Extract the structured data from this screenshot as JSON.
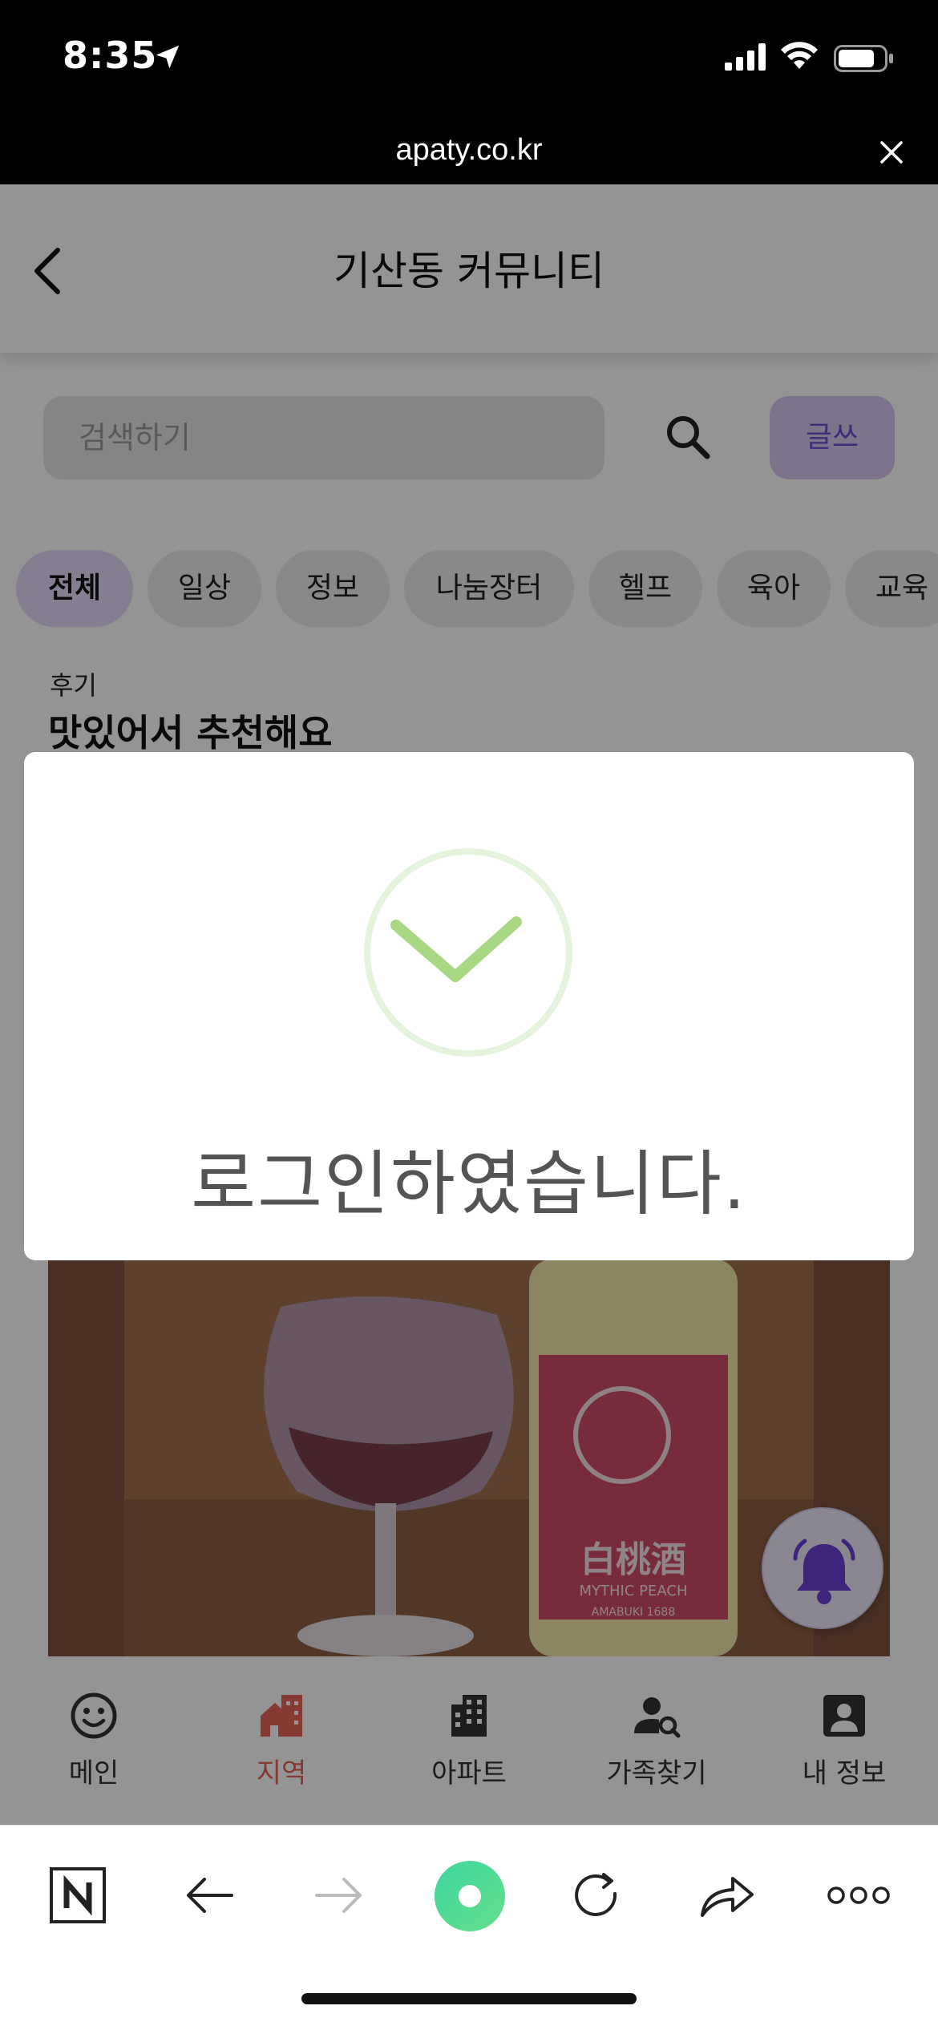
{
  "status_bar": {
    "time": "8:35",
    "icons": [
      "location-arrow-icon",
      "signal-bars-icon",
      "wifi-icon",
      "battery-icon"
    ]
  },
  "url_bar": {
    "url": "apaty.co.kr",
    "close_icon": "close-icon"
  },
  "header": {
    "back_icon": "chevron-left-icon",
    "title": "기산동 커뮤니티"
  },
  "search": {
    "placeholder": "검색하기",
    "search_icon": "search-icon",
    "write_label": "글쓰"
  },
  "categories": {
    "items": [
      "전체",
      "일상",
      "정보",
      "나눔장터",
      "헬프",
      "육아",
      "교육"
    ],
    "active": "전체"
  },
  "post": {
    "category": "후기",
    "title": "맛있어서 추천해요",
    "image_label_text": "白桃酒",
    "image_sub_text": "MYTHIC PEACH",
    "image_brand_text": "AMABUKI 1688"
  },
  "fab": {
    "icon": "bell-ringing-icon"
  },
  "tab_bar": {
    "items": [
      {
        "label": "메인",
        "icon": "smiley-icon"
      },
      {
        "label": "지역",
        "icon": "home-city-icon"
      },
      {
        "label": "아파트",
        "icon": "apartment-building-icon"
      },
      {
        "label": "가족찾기",
        "icon": "person-search-icon"
      },
      {
        "label": "내 정보",
        "icon": "account-box-icon"
      }
    ],
    "active": "지역"
  },
  "modal": {
    "icon": "check-circle-icon",
    "message": "로그인하였습니다."
  },
  "browser_toolbar": {
    "items": [
      "naver-n-icon",
      "back-arrow-icon",
      "forward-arrow-icon",
      "home-green-circle-icon",
      "reload-icon",
      "share-icon",
      "more-dots-icon"
    ]
  },
  "colors": {
    "accent_purple": "#6b4ad0",
    "active_chip": "#e6d9f8",
    "active_tab": "#e8635a",
    "check_green": "#a8d884"
  }
}
